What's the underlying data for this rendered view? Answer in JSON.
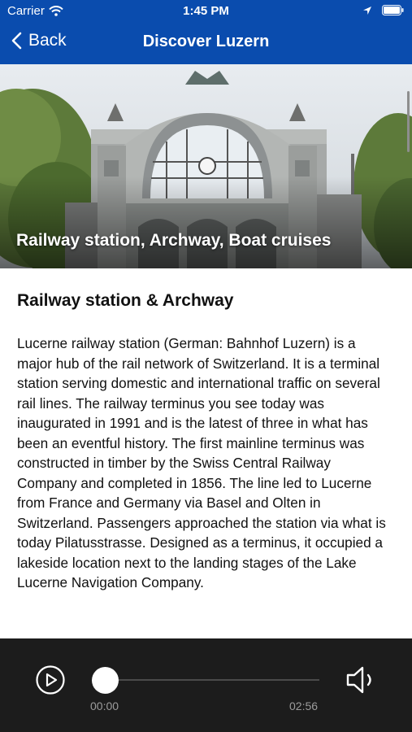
{
  "status_bar": {
    "carrier": "Carrier",
    "time": "1:45 PM",
    "icons": [
      "wifi-icon",
      "location-arrow-icon",
      "battery-icon"
    ]
  },
  "nav": {
    "back_label": "Back",
    "title": "Discover Luzern",
    "back_icon": "chevron-left-icon",
    "bar_color": "#0a4cae"
  },
  "hero": {
    "caption": "Railway station, Archway, Boat cruises"
  },
  "article": {
    "heading": "Railway station & Archway",
    "body": "Lucerne railway station (German: Bahnhof Luzern) is a major hub of the rail network of Switzerland. It is a terminal station serving domestic and international traffic on several rail lines. The railway terminus you see today was inaugurated in 1991 and is the latest of three in what has been an eventful history. The first mainline terminus was constructed in timber by the Swiss Central Railway Company and completed in 1856. The line led to Lucerne from France and Germany via Basel and Olten in Switzerland. Passengers approached the station via what is today Pilatusstrasse. Designed as a terminus, it occupied a lakeside location next to the landing stages of the Lake Lucerne Navigation Company."
  },
  "player": {
    "current_time": "00:00",
    "duration": "02:56",
    "progress": 0,
    "play_icon": "play-icon",
    "volume_icon": "volume-icon",
    "background": "#1c1c1c"
  }
}
